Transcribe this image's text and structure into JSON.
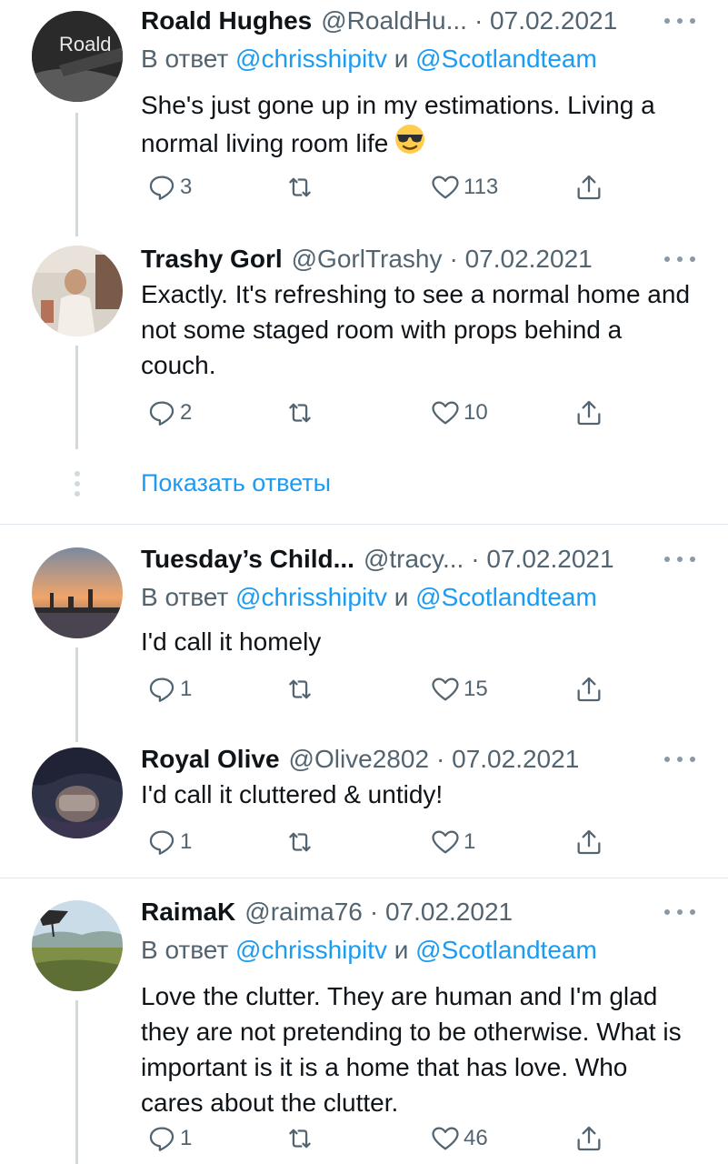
{
  "tweets": [
    {
      "name": "Roald Hughes",
      "handle": "@RoaldHu...",
      "date": "· 07.02.2021",
      "avatar_text": "Roald",
      "replying_prefix": "В ответ",
      "mention1": "@chrisshipitv",
      "conj": "и",
      "mention2": "@Scotlandteam",
      "text": "She's just gone up in my estimations. Living a normal living room life",
      "emoji": "smiling-face-with-sunglasses",
      "replies": "3",
      "retweets": "",
      "likes": "113"
    },
    {
      "name": "Trashy Gorl",
      "handle": "@GorlTrashy",
      "date": "· 07.02.2021",
      "text": "Exactly. It's refreshing to see a normal home and not some staged room with props behind a couch.",
      "replies": "2",
      "retweets": "",
      "likes": "10"
    },
    {
      "name": "Tuesday’s Child...",
      "handle": "@tracy...",
      "date": "· 07.02.2021",
      "replying_prefix": "В ответ",
      "mention1": "@chrisshipitv",
      "conj": "и",
      "mention2": "@Scotlandteam",
      "text": "I'd call it homely",
      "replies": "1",
      "retweets": "",
      "likes": "15"
    },
    {
      "name": "Royal Olive",
      "handle": "@Olive2802",
      "date": "· 07.02.2021",
      "text": "I'd call it cluttered & untidy!",
      "replies": "1",
      "retweets": "",
      "likes": "1"
    },
    {
      "name": "RaimaK",
      "handle": "@raima76",
      "date": "· 07.02.2021",
      "replying_prefix": "В ответ",
      "mention1": "@chrisshipitv",
      "conj": "и",
      "mention2": "@Scotlandteam",
      "text": "Love the clutter. They are human and I'm glad they are not pretending to be otherwise. What is important is it is a home that has love. Who cares about the clutter.",
      "replies": "1",
      "retweets": "",
      "likes": "46"
    }
  ],
  "show_replies_label": "Показать ответы",
  "colors": {
    "accent": "#1d9bf0",
    "secondary_text": "#536471",
    "thread_line": "#cfd9de",
    "divider": "#e1e8ed"
  },
  "icons": [
    "reply-icon",
    "retweet-icon",
    "like-icon",
    "share-icon",
    "more-icon"
  ]
}
